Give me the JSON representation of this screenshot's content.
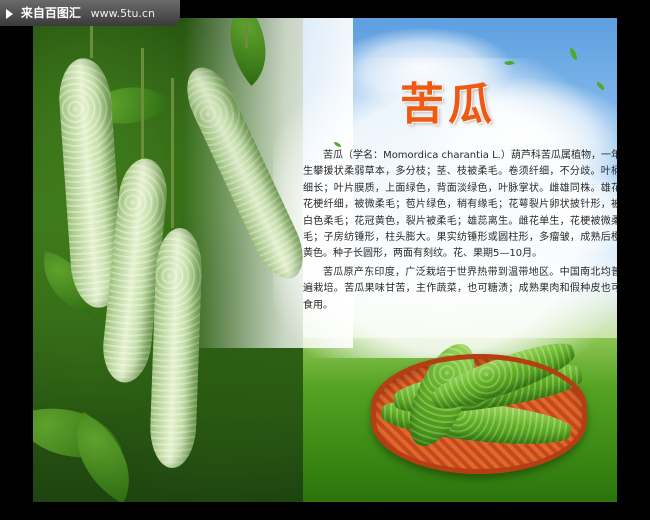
{
  "watermark": {
    "site_name": "来自百图汇",
    "url": "www.5tu.cn"
  },
  "poster": {
    "title": "苦瓜",
    "paragraphs": [
      "苦瓜（学名：Momordica charantia L.）葫芦科苦瓜属植物，一年生攀援状柔弱草本，多分枝；茎、枝被柔毛。卷须纤细，不分歧。叶柄细长；叶片膜质，上面绿色，背面淡绿色，叶脉掌状。雌雄同株。雄花花梗纤细，被微柔毛；苞片绿色，稍有缘毛；花萼裂片卵状披针形，被白色柔毛；花冠黄色，裂片被柔毛；雄蕊离生。雌花单生，花梗被微柔毛；子房纺锤形，柱头膨大。果实纺锤形或圆柱形，多瘤皱，成熟后橙黄色。种子长圆形，两面有刻纹。花、果期5—10月。",
      "苦瓜原产东印度，广泛栽培于世界热带到温带地区。中国南北均普遍栽培。苦瓜果味甘苦，主作蔬菜，也可糖渍；成熟果肉和假种皮也可食用。"
    ]
  },
  "colors": {
    "title": "#ef5a12",
    "background": "#000000",
    "body_text": "#2a2a2a"
  },
  "icons": {
    "watermark_logo": "play-triangle-icon"
  }
}
